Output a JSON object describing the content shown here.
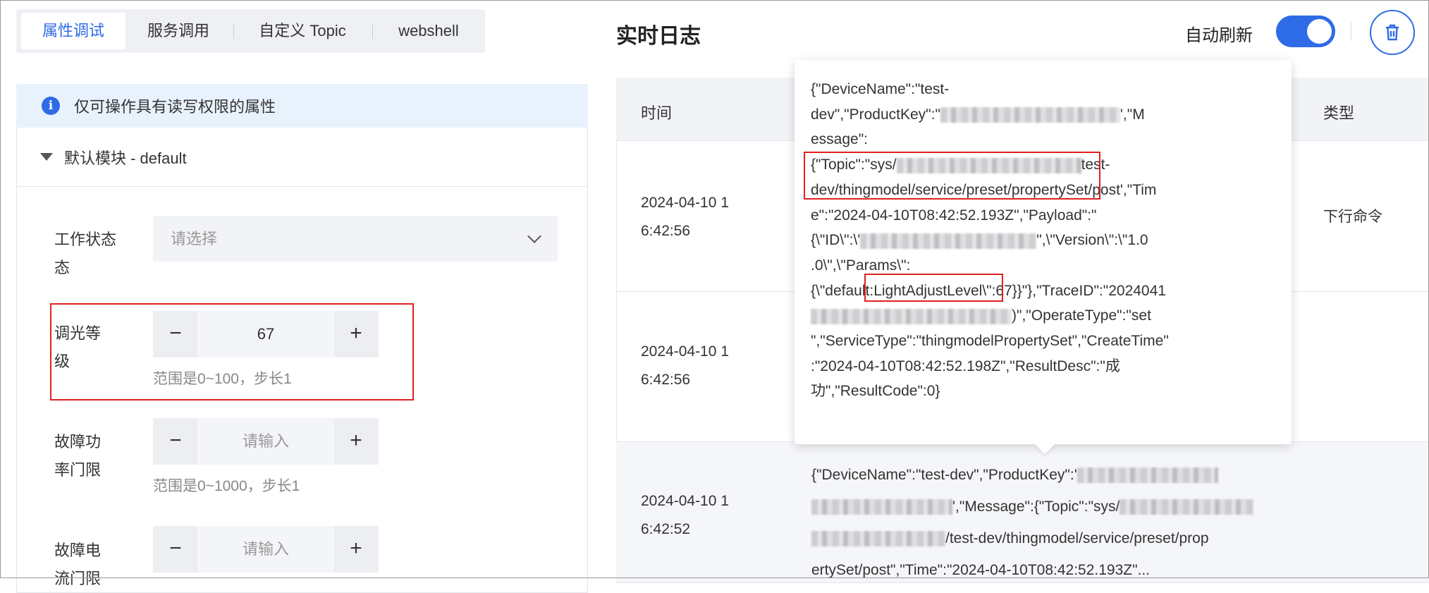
{
  "tabs": [
    {
      "label": "属性调试",
      "active": true
    },
    {
      "label": "服务调用"
    },
    {
      "label": "自定义 Topic"
    },
    {
      "label": "webshell"
    }
  ],
  "banner": {
    "icon": "info-icon",
    "text": "仅可操作具有读写权限的属性"
  },
  "module": {
    "title": "默认模块 - default"
  },
  "fields": {
    "work_state": {
      "label1": "工作状态",
      "label2": "态",
      "label_full": "工作状态",
      "placeholder": "请选择"
    },
    "light": {
      "label1": "调光等级",
      "value": "67",
      "hint": "范围是0~100，步长1"
    },
    "power": {
      "label1": "故障功",
      "label2": "率门限",
      "placeholder": "请输入",
      "hint": "范围是0~1000，步长1"
    },
    "current": {
      "label1": "故障电",
      "label2": "流门限",
      "placeholder": "请输入"
    }
  },
  "stepper": {
    "minus": "−",
    "plus": "+"
  },
  "log": {
    "title": "实时日志",
    "auto_refresh_label": "自动刷新",
    "auto_refresh_on": true,
    "accent": "#2e6be6"
  },
  "table": {
    "headers": {
      "time": "时间",
      "type": "类型"
    },
    "rows": [
      {
        "time1": "2024-04-10 1",
        "time2": "6:42:56",
        "type": "下行命令"
      },
      {
        "time1": "2024-04-10 1",
        "time2": "6:42:56",
        "type": ""
      },
      {
        "time1": "2024-04-10 1",
        "time2": "6:42:52",
        "type": "",
        "message_lines": [
          [
            {
              "t": "{\"DeviceName\":\"test-dev\",\"ProductKey\":'"
            },
            {
              "r": 200
            }
          ],
          [
            {
              "r": 200
            },
            {
              "t": "',\"Message\":{\"Topic\":\"sys/"
            },
            {
              "r": 190
            }
          ],
          [
            {
              "r": 190
            },
            {
              "t": "/test-dev/thingmodel/service/preset/prop"
            }
          ],
          [
            {
              "t": "ertySet/post\",\"Time\":\"2024-04-10T08:42:52.193Z\"..."
            }
          ]
        ]
      }
    ]
  },
  "tooltip": {
    "lines": [
      [
        {
          "t": "{\"DeviceName\":\"test-"
        }
      ],
      [
        {
          "t": "dev\",\"ProductKey\":\""
        },
        {
          "r": 255
        },
        {
          "t": "',\"M"
        }
      ],
      [
        {
          "t": "essage\":"
        }
      ],
      [
        {
          "t": "{\"Topic\":\"sys/"
        },
        {
          "r": 262
        },
        {
          "t": "test-"
        }
      ],
      [
        {
          "t": "dev/thingmodel/service/preset/propertySet/post'"
        },
        {
          "t": ",\"Tim"
        }
      ],
      [
        {
          "t": "e\":\"2024-04-10T08:42:52.193Z\",\"Payload\":\""
        }
      ],
      [
        {
          "t": "{\\\"ID\\\":\\'"
        },
        {
          "r": 250
        },
        {
          "t": "\",\\\"Version\\\":\\\"1.0"
        }
      ],
      [
        {
          "t": ".0\\\",\\\"Params\\\":"
        }
      ],
      [
        {
          "t": "{\\\"default:LightAdjustLevel\\\":67}}\"},\"TraceID\":\"2024041"
        }
      ],
      [
        {
          "r": 285
        },
        {
          "t": ")\",\"OperateType\":\"set"
        }
      ],
      [
        {
          "t": "\",\"ServiceType\":\"thingmodelPropertySet\",\"CreateTime\""
        }
      ],
      [
        {
          "t": ":\"2024-04-10T08:42:52.198Z\",\"ResultDesc\":\"成"
        }
      ],
      [
        {
          "t": "功\",\"ResultCode\":0}"
        }
      ]
    ]
  }
}
